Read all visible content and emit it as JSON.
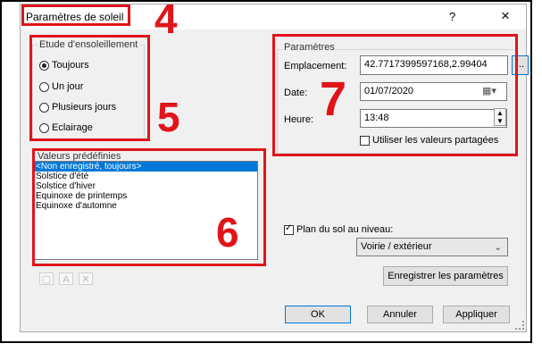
{
  "dialog": {
    "title": "Paramètres de soleil",
    "help_label": "?",
    "close_label": "×"
  },
  "annotations": {
    "n4": "4",
    "n5": "5",
    "n6": "6",
    "n7": "7"
  },
  "etude": {
    "legend": "Etude d'ensoleillement",
    "options": [
      {
        "label": "Toujours",
        "selected": true
      },
      {
        "label": "Un jour",
        "selected": false
      },
      {
        "label": "Plusieurs jours",
        "selected": false
      },
      {
        "label": "Eclairage",
        "selected": false
      }
    ]
  },
  "presets": {
    "legend": "Valeurs prédéfinies",
    "items": [
      "<Non enregistré, toujours>",
      "Solstice d'été",
      "Solstice d'hiver",
      "Equinoxe de printemps",
      "Equinoxe d'automne"
    ],
    "selected_index": 0
  },
  "params": {
    "legend": "Paramètres",
    "location_label": "Emplacement:",
    "location_value": "42.7717399597168,2.99404",
    "browse_label": "...",
    "date_label": "Date:",
    "date_value": "01/07/2020",
    "time_label": "Heure:",
    "time_value": "13:48",
    "shared_label": "Utiliser les valeurs partagées",
    "shared_checked": false
  },
  "ground": {
    "label": "Plan du sol au niveau:",
    "checked": true,
    "level_value": "Voirie / extérieur"
  },
  "buttons": {
    "save": "Enregistrer les paramètres",
    "ok": "OK",
    "cancel": "Annuler",
    "apply": "Appliquer"
  },
  "colors": {
    "annotation": "#e0141a",
    "selection": "#0078d7"
  }
}
